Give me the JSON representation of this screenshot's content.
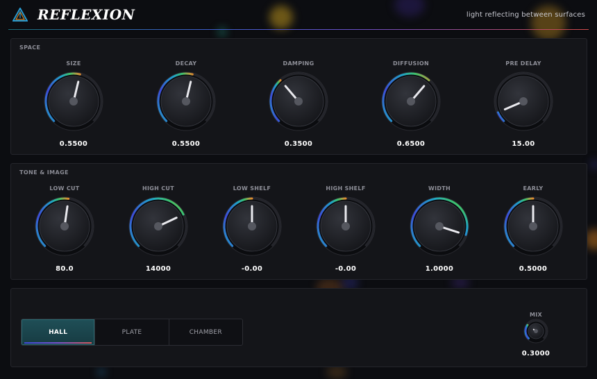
{
  "header": {
    "title": "REFLEXION",
    "tagline": "light reflecting between surfaces"
  },
  "space": {
    "title": "SPACE",
    "knobs": [
      {
        "label": "SIZE",
        "value": "0.5500",
        "level": 0.55
      },
      {
        "label": "DECAY",
        "value": "0.5500",
        "level": 0.55
      },
      {
        "label": "DAMPING",
        "value": "0.3500",
        "level": 0.35
      },
      {
        "label": "DIFFUSION",
        "value": "0.6500",
        "level": 0.65
      },
      {
        "label": "PRE DELAY",
        "value": "15.00",
        "level": 0.08
      }
    ]
  },
  "tone": {
    "title": "TONE & IMAGE",
    "knobs": [
      {
        "label": "LOW CUT",
        "value": "80.0",
        "level": 0.53
      },
      {
        "label": "HIGH CUT",
        "value": "14000",
        "level": 0.74
      },
      {
        "label": "LOW SHELF",
        "value": "-0.00",
        "level": 0.5
      },
      {
        "label": "HIGH SHELF",
        "value": "-0.00",
        "level": 0.5
      },
      {
        "label": "WIDTH",
        "value": "1.0000",
        "level": 0.9
      },
      {
        "label": "EARLY",
        "value": "0.5000",
        "level": 0.5
      }
    ]
  },
  "modes": {
    "options": [
      "HALL",
      "PLATE",
      "CHAMBER"
    ],
    "selected": "HALL"
  },
  "mix": {
    "label": "MIX",
    "value": "0.3000",
    "level": 0.3
  },
  "colors": {
    "background": "#0c0d11",
    "panel": "#141519",
    "arc_blue": "#3d4bd8",
    "arc_cyan": "#1fa5c8",
    "arc_green": "#3fc36a",
    "arc_orange": "#e68a2e",
    "accent_teal": "#1f4f57"
  },
  "icons": {
    "logo": "prism-triangle-icon"
  }
}
